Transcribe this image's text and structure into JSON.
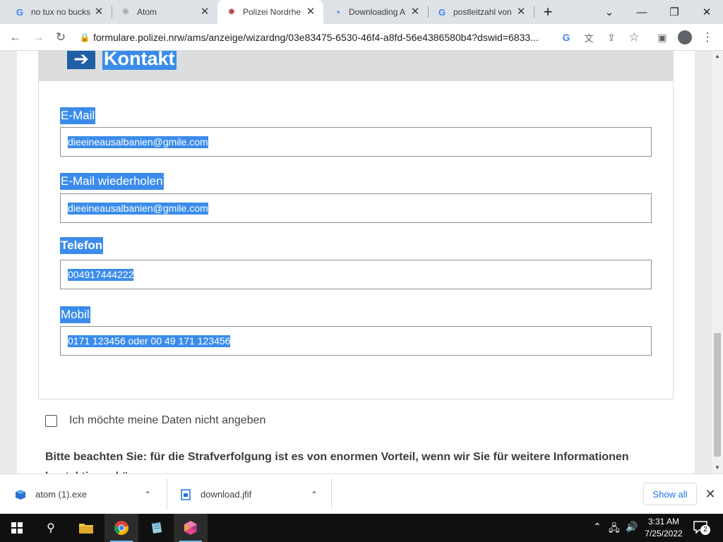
{
  "browser": {
    "tabs": [
      {
        "title": "no tux no bucks",
        "favicon": "google-g-icon"
      },
      {
        "title": "Atom",
        "favicon": "atom-icon"
      },
      {
        "title": "Polizei Nordrhe",
        "favicon": "polizei-icon",
        "active": true
      },
      {
        "title": "Downloading A",
        "favicon": "loading-icon"
      },
      {
        "title": "postleitzahl von",
        "favicon": "google-g-icon"
      }
    ],
    "url": "formulare.polizei.nrw/ams/anzeige/wizardng/03e83475-6530-46f4-a8fd-56e4386580b4?dswid=6833..."
  },
  "form": {
    "section_title": "Kontakt",
    "fields": [
      {
        "label": "E-Mail",
        "value": "dieeineausalbanien@gmile.com"
      },
      {
        "label": "E-Mail wiederholen",
        "value": "dieeineausalbanien@gmile.com"
      },
      {
        "label": "Telefon",
        "value": "004917444222"
      },
      {
        "label": "Mobil",
        "value": "0171 123456 oder 00 49 171 123456"
      }
    ],
    "opt_out_label": "Ich möchte meine Daten nicht angeben",
    "notice": "Bitte beachten Sie: für die Strafverfolgung ist es von enormen Vorteil, wenn wir Sie für weitere Informationen kontaktieren können."
  },
  "downloads": {
    "items": [
      {
        "name": "atom (1).exe",
        "icon": "installer-icon"
      },
      {
        "name": "download.jfif",
        "icon": "image-file-icon"
      }
    ],
    "show_all": "Show all"
  },
  "taskbar": {
    "time": "3:31 AM",
    "date": "7/25/2022",
    "notification_count": "2"
  },
  "colors": {
    "selection": "#3b8cea",
    "accent_blue": "#1f5fa6",
    "link": "#1a73e8"
  }
}
